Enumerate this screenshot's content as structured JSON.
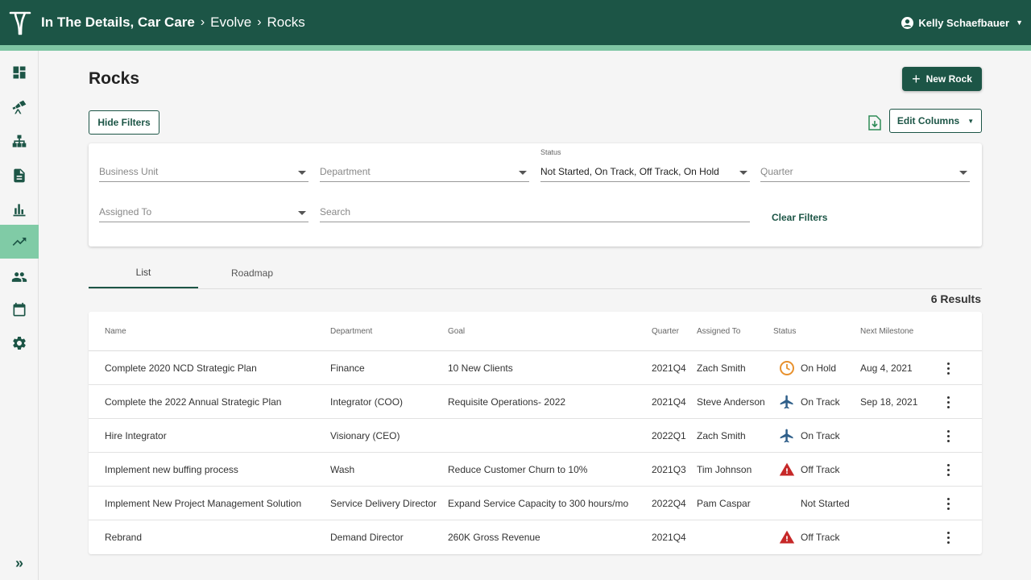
{
  "breadcrumb": [
    "In The Details, Car Care",
    "Evolve",
    "Rocks"
  ],
  "user": {
    "name": "Kelly Schaefbauer"
  },
  "sidebar": {
    "items": [
      {
        "icon": "dashboard-icon"
      },
      {
        "icon": "telescope-icon"
      },
      {
        "icon": "org-chart-icon"
      },
      {
        "icon": "document-icon"
      },
      {
        "icon": "bar-chart-icon"
      },
      {
        "icon": "trending-up-icon",
        "active": true
      },
      {
        "icon": "people-icon"
      },
      {
        "icon": "calendar-icon"
      },
      {
        "icon": "gear-icon"
      }
    ],
    "expand": "»"
  },
  "page": {
    "title": "Rocks",
    "new_button": "New Rock",
    "hide_filters": "Hide Filters",
    "edit_columns": "Edit Columns"
  },
  "filters": {
    "business_unit": "Business Unit",
    "department": "Department",
    "status_label": "Status",
    "status_value": "Not Started, On Track, Off Track, On Hold",
    "quarter": "Quarter",
    "assigned_to": "Assigned To",
    "search_placeholder": "Search",
    "clear": "Clear Filters"
  },
  "tabs": [
    "List",
    "Roadmap"
  ],
  "results": "6 Results",
  "table": {
    "columns": [
      "Name",
      "Department",
      "Goal",
      "Quarter",
      "Assigned To",
      "Status",
      "Next Milestone"
    ],
    "rows": [
      {
        "name": "Complete 2020 NCD Strategic Plan",
        "department": "Finance",
        "goal": "10 New Clients",
        "quarter": "2021Q4",
        "assigned": "Zach Smith",
        "status": "On Hold",
        "status_icon": "clock-icon",
        "milestone": "Aug 4, 2021"
      },
      {
        "name": "Complete the 2022 Annual Strategic Plan",
        "department": "Integrator (COO)",
        "goal": "Requisite Operations- 2022",
        "quarter": "2021Q4",
        "assigned": "Steve Anderson",
        "status": "On Track",
        "status_icon": "airplane-icon",
        "milestone": "Sep 18, 2021"
      },
      {
        "name": "Hire Integrator",
        "department": "Visionary (CEO)",
        "goal": "",
        "quarter": "2022Q1",
        "assigned": "Zach Smith",
        "status": "On Track",
        "status_icon": "airplane-icon",
        "milestone": ""
      },
      {
        "name": "Implement new buffing process",
        "department": "Wash",
        "goal": "Reduce Customer Churn to 10%",
        "quarter": "2021Q3",
        "assigned": "Tim Johnson",
        "status": "Off Track",
        "status_icon": "warning-icon",
        "milestone": ""
      },
      {
        "name": "Implement New Project Management Solution",
        "department": "Service Delivery Director",
        "goal": "Expand Service Capacity to 300 hours/mo",
        "quarter": "2022Q4",
        "assigned": "Pam Caspar",
        "status": "Not Started",
        "status_icon": "",
        "milestone": ""
      },
      {
        "name": "Rebrand",
        "department": "Demand Director",
        "goal": "260K Gross Revenue",
        "quarter": "2021Q4",
        "assigned": "",
        "status": "Off Track",
        "status_icon": "warning-icon",
        "milestone": ""
      }
    ]
  },
  "colors": {
    "primary": "#1c5546",
    "accent": "#7fc6a4",
    "on_hold": "#e8912d",
    "on_track": "#2f5f8a",
    "off_track": "#c62828"
  }
}
